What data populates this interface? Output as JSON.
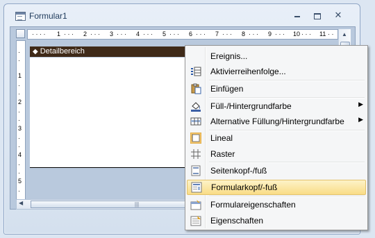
{
  "window": {
    "title": "Formular1"
  },
  "ruler": {
    "h_marks": [
      "1",
      "2",
      "3",
      "4",
      "5",
      "6",
      "7",
      "8",
      "9",
      "10",
      "11"
    ],
    "v_marks": [
      "1",
      "2",
      "3",
      "4",
      "5"
    ]
  },
  "section": {
    "label": "Detailbereich"
  },
  "colors": {
    "section_header": "#3f2a18",
    "highlight": "#f9dc86",
    "menu_bg": "#f5f6f7"
  },
  "menu": {
    "items": [
      {
        "label": "Ereignis...",
        "icon": "none",
        "submenu": false
      },
      {
        "label": "Aktivierreihenfolge...",
        "icon": "tab-order-icon",
        "submenu": false
      },
      {
        "label": "Einfügen",
        "icon": "paste-icon",
        "submenu": false
      },
      {
        "label": "Füll-/Hintergrundfarbe",
        "icon": "fill-color-icon",
        "submenu": true
      },
      {
        "label": "Alternative Füllung/Hintergrundfarbe",
        "icon": "alternate-fill-icon",
        "submenu": true
      },
      {
        "label": "Lineal",
        "icon": "ruler-icon",
        "submenu": false
      },
      {
        "label": "Raster",
        "icon": "grid-icon",
        "submenu": false
      },
      {
        "label": "Seitenkopf-/fuß",
        "icon": "page-header-icon",
        "submenu": false
      },
      {
        "label": "Formularkopf/-fuß",
        "icon": "form-header-icon",
        "submenu": false,
        "highlighted": true
      },
      {
        "label": "Formulareigenschaften",
        "icon": "form-properties-icon",
        "submenu": false
      },
      {
        "label": "Eigenschaften",
        "icon": "properties-icon",
        "submenu": false
      }
    ]
  }
}
